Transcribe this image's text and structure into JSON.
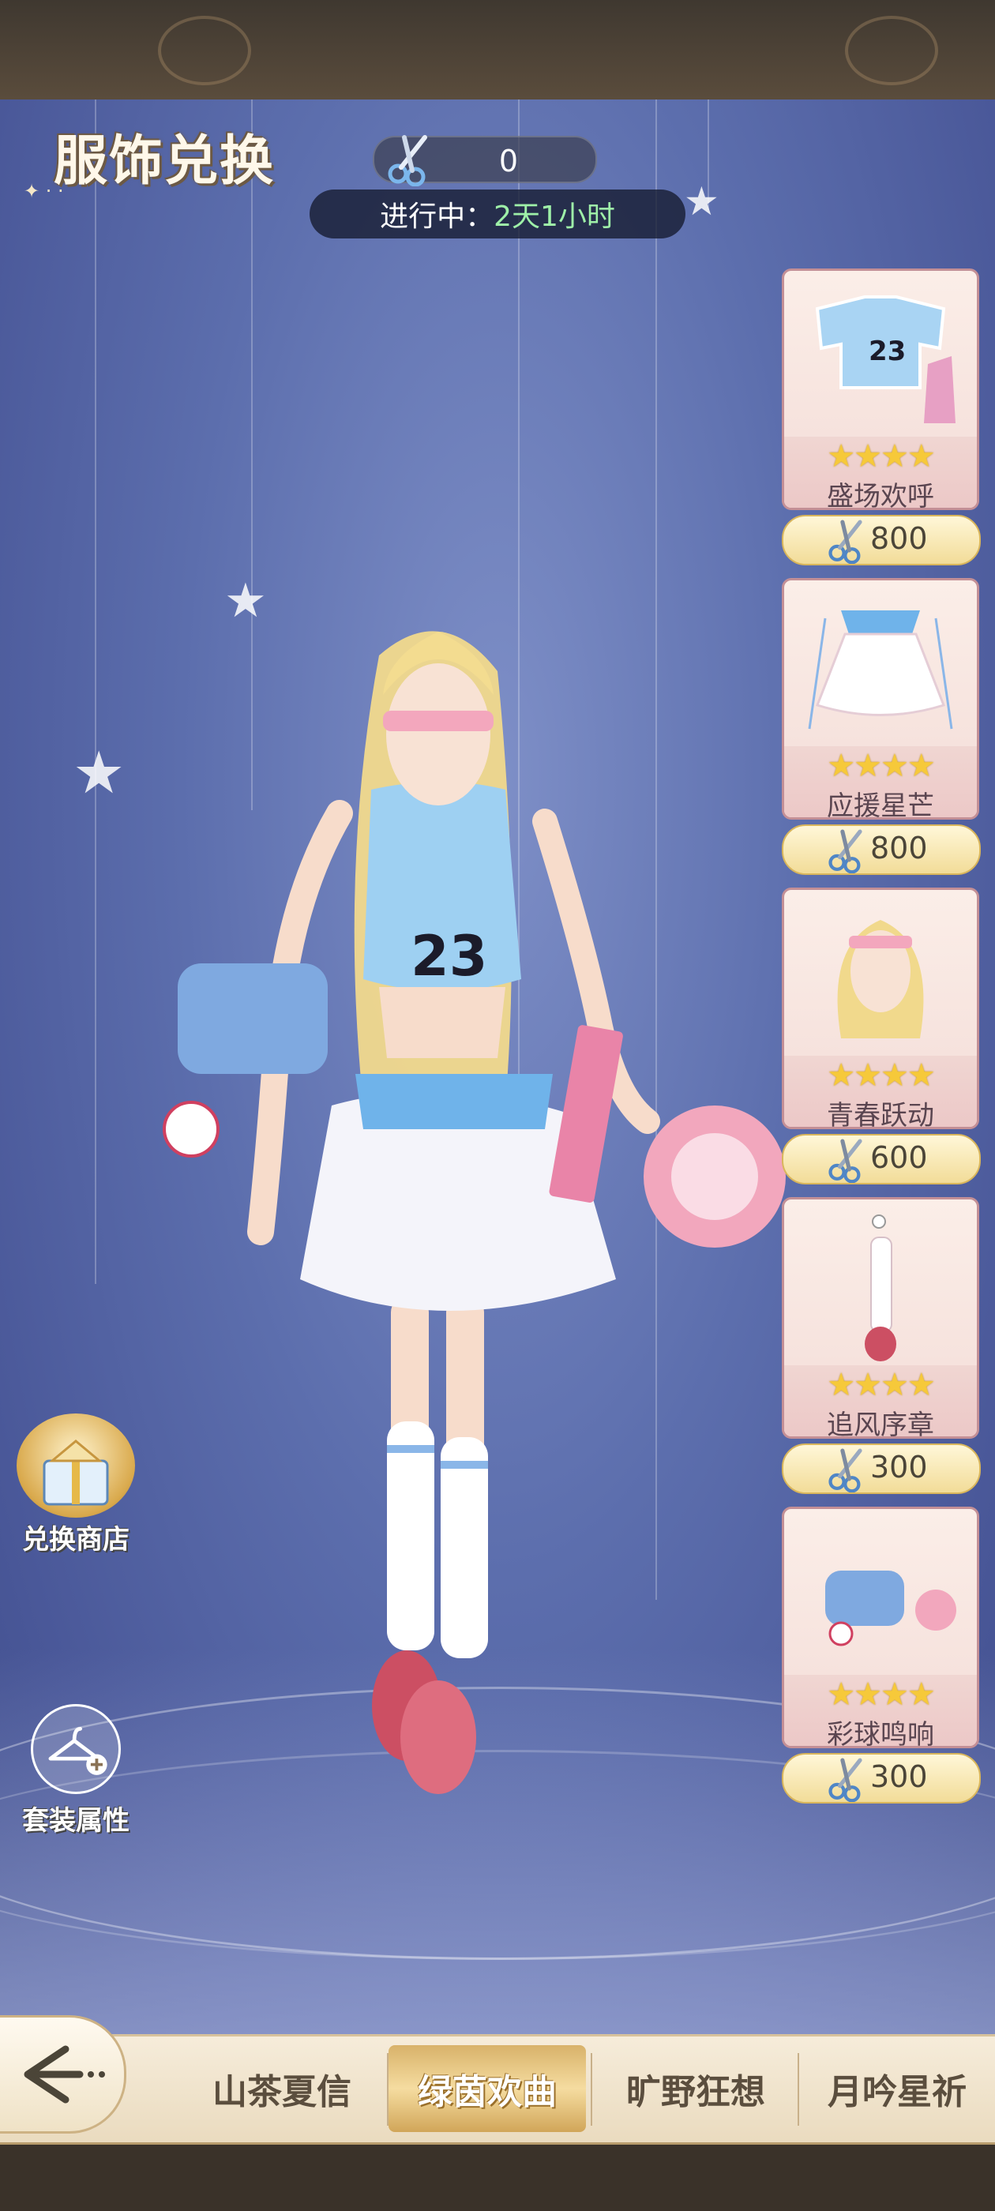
{
  "header": {
    "title": "服饰兑换"
  },
  "currency": {
    "icon": "scissors-icon",
    "amount": "0"
  },
  "status": {
    "label": "进行中：",
    "value": "2天1小时",
    "value_color": "#9ef0a8"
  },
  "items": [
    {
      "name": "盛场欢呼",
      "stars": "★★★★",
      "price": "800",
      "icon": "jersey-top-icon"
    },
    {
      "name": "应援星芒",
      "stars": "★★★★",
      "price": "800",
      "icon": "skirt-icon"
    },
    {
      "name": "青春跃动",
      "stars": "★★★★",
      "price": "600",
      "icon": "hairstyle-icon"
    },
    {
      "name": "追风序章",
      "stars": "★★★★",
      "price": "300",
      "icon": "socks-shoes-icon"
    },
    {
      "name": "彩球鸣响",
      "stars": "★★★★",
      "price": "300",
      "icon": "bag-pompom-icon"
    }
  ],
  "side_buttons": {
    "shop_label": "兑换商店",
    "attributes_label": "套装属性"
  },
  "tabs": [
    {
      "label": "山茶夏信",
      "active": false
    },
    {
      "label": "绿茵欢曲",
      "active": true
    },
    {
      "label": "旷野狂想",
      "active": false
    },
    {
      "label": "月吟星祈",
      "active": false
    }
  ],
  "colors": {
    "accent_gold": "#d8b26a",
    "card_border": "#c38f96",
    "star": "#f6c93a"
  }
}
